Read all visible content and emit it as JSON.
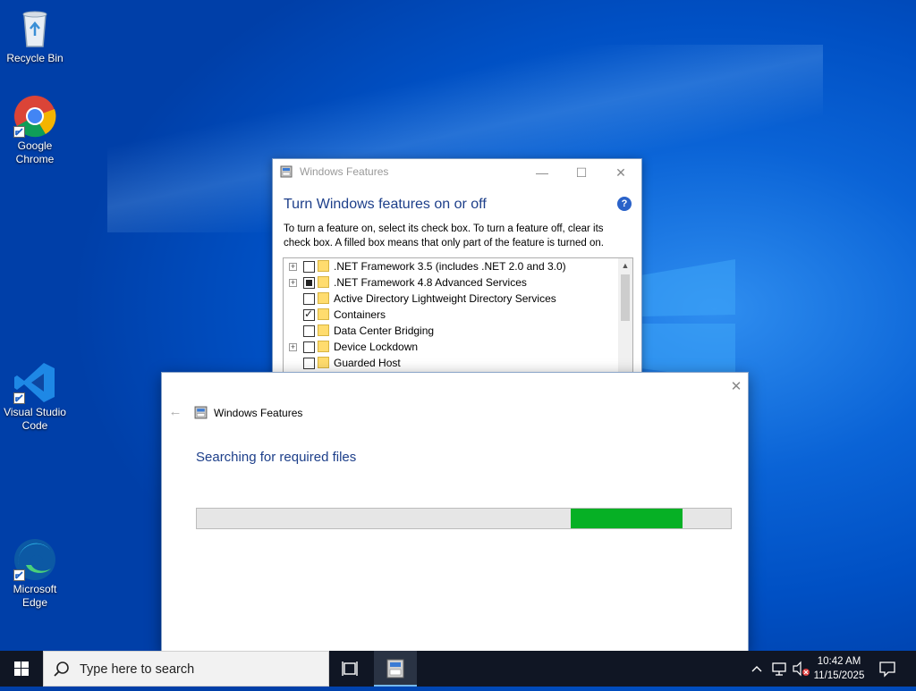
{
  "desktop": {
    "icons": [
      {
        "label": "Recycle Bin"
      },
      {
        "label": "Google Chrome"
      },
      {
        "label": "Visual Studio Code"
      },
      {
        "label": "Microsoft Edge"
      }
    ]
  },
  "features_window": {
    "title": "Windows Features",
    "heading": "Turn Windows features on or off",
    "description": "To turn a feature on, select its check box. To turn a feature off, clear its check box. A filled box means that only part of the feature is turned on.",
    "features": [
      {
        "label": ".NET Framework 3.5 (includes .NET 2.0 and 3.0)",
        "state": "unchecked",
        "expandable": true
      },
      {
        "label": ".NET Framework 4.8 Advanced Services",
        "state": "partial",
        "expandable": true
      },
      {
        "label": "Active Directory Lightweight Directory Services",
        "state": "unchecked",
        "expandable": false
      },
      {
        "label": "Containers",
        "state": "checked",
        "expandable": false
      },
      {
        "label": "Data Center Bridging",
        "state": "unchecked",
        "expandable": false
      },
      {
        "label": "Device Lockdown",
        "state": "unchecked",
        "expandable": true
      },
      {
        "label": "Guarded Host",
        "state": "unchecked",
        "expandable": false
      }
    ]
  },
  "progress_dialog": {
    "title": "Windows Features",
    "heading": "Searching for required files",
    "progress": {
      "mode": "marquee",
      "segment_start": 0.7,
      "segment_end": 0.91,
      "color": "#06b025"
    }
  },
  "taskbar": {
    "search_placeholder": "Type here to search",
    "time": "10:42 AM",
    "date": "11/15/2025"
  },
  "colors": {
    "heading_blue": "#1d3f8a",
    "progress_green": "#06b025",
    "taskbar": "#101624"
  }
}
